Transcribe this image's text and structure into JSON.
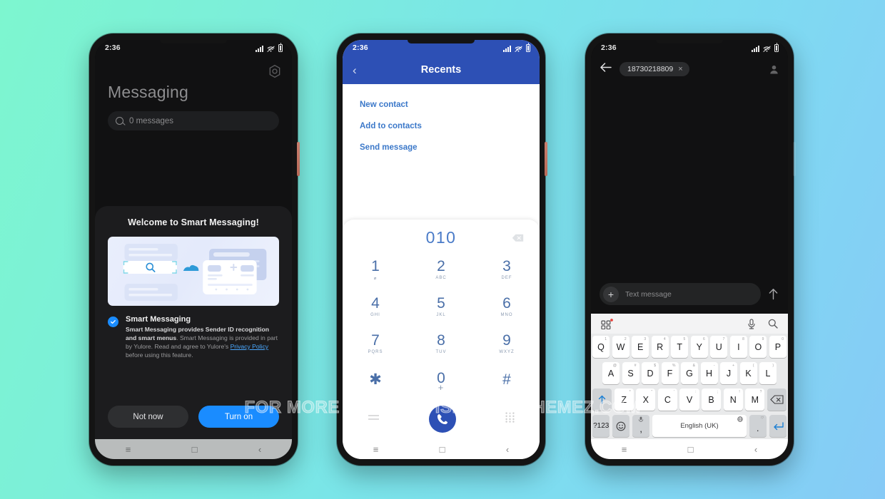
{
  "background": {
    "from": "#7df6cf",
    "to": "#86caf6"
  },
  "watermark": "FOR MORE THEMES VISIT - MIUITHEMEZ.COM",
  "phone1": {
    "status": {
      "time": "2:36"
    },
    "app_title": "Messaging",
    "search_placeholder": "0 messages",
    "settings_icon": "gear-icon",
    "sheet": {
      "heading": "Welcome to Smart Messaging!",
      "feature_title": "Smart Messaging",
      "body_bold": "Smart Messaging provides Sender ID recognition and smart menus",
      "body_rest_1": ". Smart Messaging is provided in part by Yulore. Read and agree to Yulore's ",
      "link": "Privacy Policy",
      "body_rest_2": " before using this feature.",
      "secondary_button": "Not now",
      "primary_button": "Turn on",
      "primary_color": "#1a8cff"
    },
    "nav": {
      "recents": "≡",
      "home": "□",
      "back": "‹"
    }
  },
  "phone2": {
    "status": {
      "time": "2:36"
    },
    "header": {
      "title": "Recents",
      "back_icon": "chevron-left-icon",
      "color": "#2d50b5"
    },
    "list": [
      "New contact",
      "Add to contacts",
      "Send message"
    ],
    "dialpad": {
      "entry": "010",
      "delete_icon": "backspace-icon",
      "keys": [
        {
          "digit": "1",
          "letters": "⌀"
        },
        {
          "digit": "2",
          "letters": "ABC"
        },
        {
          "digit": "3",
          "letters": "DEF"
        },
        {
          "digit": "4",
          "letters": "GHI"
        },
        {
          "digit": "5",
          "letters": "JKL"
        },
        {
          "digit": "6",
          "letters": "MNO"
        },
        {
          "digit": "7",
          "letters": "PQRS"
        },
        {
          "digit": "8",
          "letters": "TUV"
        },
        {
          "digit": "9",
          "letters": "WXYZ"
        },
        {
          "digit": "✱",
          "letters": ""
        },
        {
          "digit": "0",
          "letters": "+"
        },
        {
          "digit": "#",
          "letters": ""
        }
      ],
      "call_button_color": "#2d50b5"
    },
    "nav": {
      "recents": "≡",
      "home": "□",
      "back": "‹"
    }
  },
  "phone3": {
    "status": {
      "time": "2:36"
    },
    "recipient": "18730218809",
    "recipient_remove": "×",
    "back_icon": "arrow-left-icon",
    "contact_icon": "person-icon",
    "composer": {
      "attach": "+",
      "placeholder": "Text message",
      "send_icon": "arrow-up-icon"
    },
    "keyboard": {
      "toolbar": {
        "apps_icon": "grid-icon",
        "mic_icon": "microphone-icon",
        "search_icon": "search-icon"
      },
      "row1": [
        {
          "k": "Q",
          "n": "1"
        },
        {
          "k": "W",
          "n": "2"
        },
        {
          "k": "E",
          "n": "3"
        },
        {
          "k": "R",
          "n": "4"
        },
        {
          "k": "T",
          "n": "5"
        },
        {
          "k": "Y",
          "n": "6"
        },
        {
          "k": "U",
          "n": "7"
        },
        {
          "k": "I",
          "n": "8"
        },
        {
          "k": "O",
          "n": "9"
        },
        {
          "k": "P",
          "n": "0"
        }
      ],
      "row2": [
        {
          "k": "A",
          "n": "@"
        },
        {
          "k": "S",
          "n": "#"
        },
        {
          "k": "D",
          "n": "$"
        },
        {
          "k": "F",
          "n": "%"
        },
        {
          "k": "G",
          "n": "&"
        },
        {
          "k": "H",
          "n": "-"
        },
        {
          "k": "J",
          "n": "+"
        },
        {
          "k": "K",
          "n": "("
        },
        {
          "k": "L",
          "n": ")"
        }
      ],
      "row3": [
        {
          "k": "Z",
          "n": "*"
        },
        {
          "k": "X",
          "n": "\""
        },
        {
          "k": "C",
          "n": "'"
        },
        {
          "k": "V",
          "n": ":"
        },
        {
          "k": "B",
          "n": ";"
        },
        {
          "k": "N",
          "n": "!"
        },
        {
          "k": "M",
          "n": "?"
        }
      ],
      "shift_icon": "shift-arrow-icon",
      "backspace_icon": "backspace-icon",
      "symbols_key": "?123",
      "emoji_key": "☺",
      "comma_key": ",",
      "comma_sup_icon": "microphone-icon",
      "space_label": "English (UK)",
      "space_sup_icon": "globe-icon",
      "period_key": ".",
      "period_sup": "!?",
      "enter_icon": "enter-arrow-icon"
    },
    "nav": {
      "recents": "≡",
      "home": "□",
      "back": "‹"
    }
  }
}
